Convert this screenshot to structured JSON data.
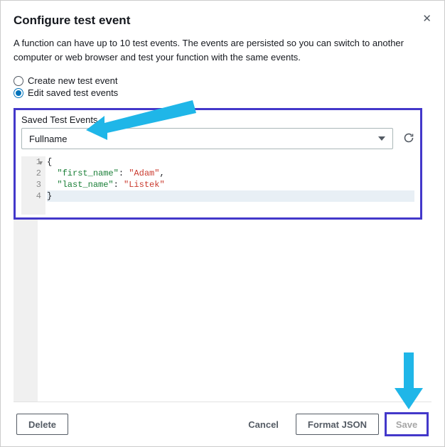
{
  "header": {
    "title": "Configure test event"
  },
  "description": "A function can have up to 10 test events. The events are persisted so you can switch to another computer or web browser and test your function with the same events.",
  "radios": {
    "create_label": "Create new test event",
    "edit_label": "Edit saved test events"
  },
  "saved": {
    "section_label": "Saved Test Events",
    "selected": "Fullname"
  },
  "code": {
    "line1": "{",
    "line2_key": "\"first_name\"",
    "line2_val": "\"Adam\"",
    "line3_key": "\"last_name\"",
    "line3_val": "\"Listek\"",
    "line4": "}"
  },
  "gutter": {
    "n1": "1",
    "n2": "2",
    "n3": "3",
    "n4": "4"
  },
  "footer": {
    "delete": "Delete",
    "cancel": "Cancel",
    "format": "Format JSON",
    "save": "Save"
  },
  "icons": {
    "close": "✕"
  }
}
